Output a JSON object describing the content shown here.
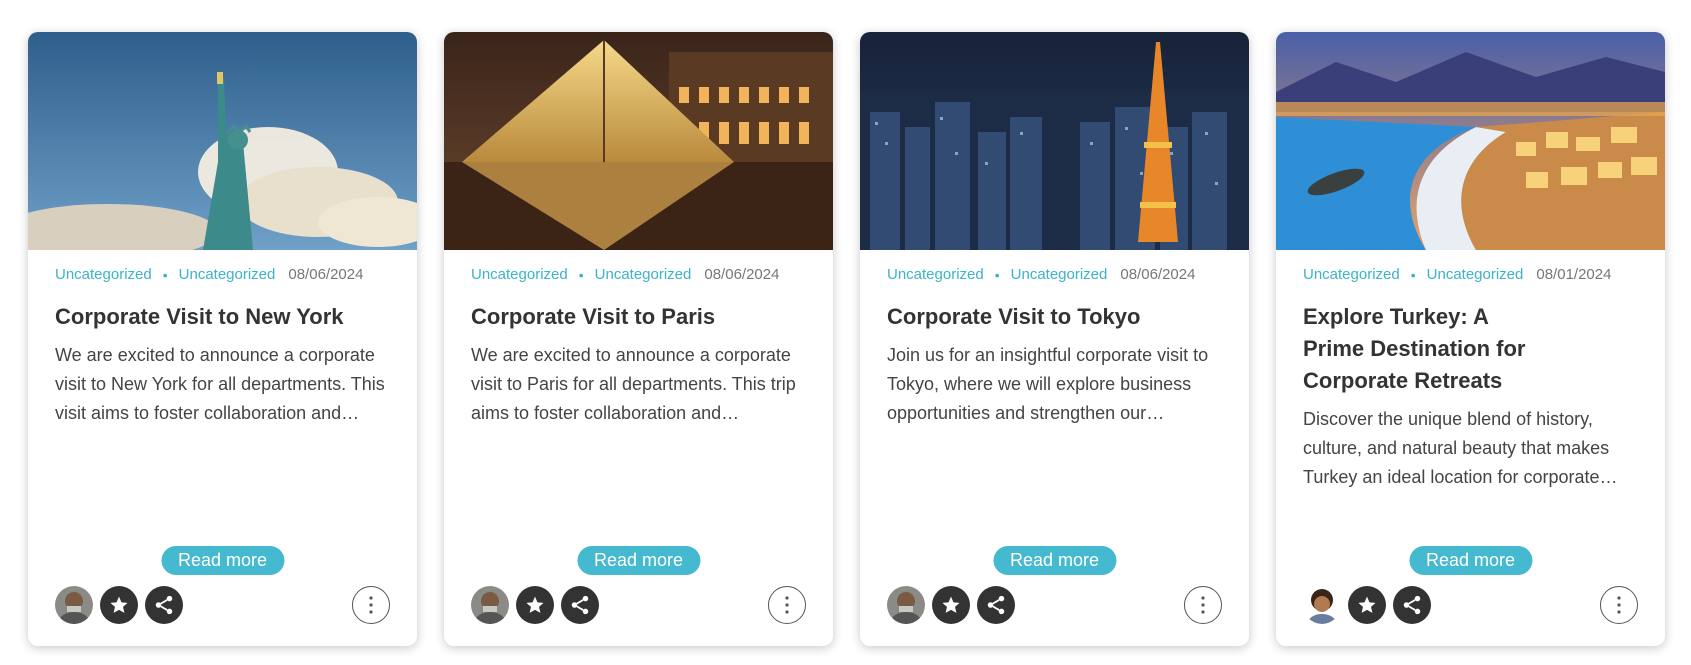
{
  "posts": [
    {
      "image": "statue-of-liberty-photo",
      "cat1": "Uncategorized",
      "cat2": "Uncategorized",
      "date": "08/06/2024",
      "title": "Corporate Visit to New York",
      "excerpt": "We are excited to announce a corporate visit to New York for all departments. This visit aims to foster collaboration and innovation.",
      "read_more": "Read more",
      "author_avatar": "author-avatar-1"
    },
    {
      "image": "louvre-pyramid-photo",
      "cat1": "Uncategorized",
      "cat2": "Uncategorized",
      "date": "08/06/2024",
      "title": "Corporate Visit to Paris",
      "excerpt": "We are excited to announce a corporate visit to Paris for all departments. This trip aims to foster collaboration and innovation.",
      "read_more": "Read more",
      "author_avatar": "author-avatar-1"
    },
    {
      "image": "tokyo-tower-night-photo",
      "cat1": "Uncategorized",
      "cat2": "Uncategorized",
      "date": "08/06/2024",
      "title": "Corporate Visit to Tokyo",
      "excerpt": "Join us for an insightful corporate visit to Tokyo, where we will explore business opportunities and strengthen our partnerships.",
      "read_more": "Read more",
      "author_avatar": "author-avatar-1"
    },
    {
      "image": "turkey-coast-night-photo",
      "cat1": "Uncategorized",
      "cat2": "Uncategorized",
      "date": "08/01/2024",
      "title": "Explore Turkey: A Prime Destination for Corporate Retreats",
      "excerpt": "Discover the unique blend of history, culture, and natural beauty that makes Turkey an ideal location for corporate retreats.",
      "read_more": "Read more",
      "author_avatar": "author-avatar-2"
    }
  ],
  "colors": {
    "accent": "#45b9cf",
    "link": "#3bb3c9",
    "icon_bg": "#333333"
  },
  "icons": {
    "star": "star-icon",
    "share": "share-icon",
    "more": "more-vertical-icon"
  }
}
